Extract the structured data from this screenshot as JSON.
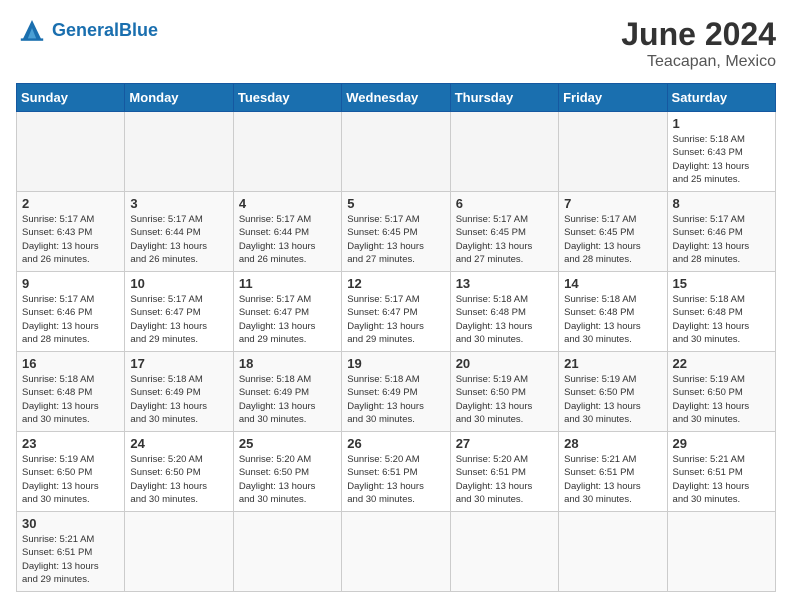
{
  "header": {
    "logo_general": "General",
    "logo_blue": "Blue",
    "title": "June 2024",
    "subtitle": "Teacapan, Mexico"
  },
  "days_of_week": [
    "Sunday",
    "Monday",
    "Tuesday",
    "Wednesday",
    "Thursday",
    "Friday",
    "Saturday"
  ],
  "weeks": [
    [
      {
        "day": "",
        "info": ""
      },
      {
        "day": "",
        "info": ""
      },
      {
        "day": "",
        "info": ""
      },
      {
        "day": "",
        "info": ""
      },
      {
        "day": "",
        "info": ""
      },
      {
        "day": "",
        "info": ""
      },
      {
        "day": "1",
        "info": "Sunrise: 5:18 AM\nSunset: 6:43 PM\nDaylight: 13 hours\nand 25 minutes."
      }
    ],
    [
      {
        "day": "2",
        "info": "Sunrise: 5:17 AM\nSunset: 6:43 PM\nDaylight: 13 hours\nand 26 minutes."
      },
      {
        "day": "3",
        "info": "Sunrise: 5:17 AM\nSunset: 6:44 PM\nDaylight: 13 hours\nand 26 minutes."
      },
      {
        "day": "4",
        "info": "Sunrise: 5:17 AM\nSunset: 6:44 PM\nDaylight: 13 hours\nand 26 minutes."
      },
      {
        "day": "5",
        "info": "Sunrise: 5:17 AM\nSunset: 6:45 PM\nDaylight: 13 hours\nand 27 minutes."
      },
      {
        "day": "6",
        "info": "Sunrise: 5:17 AM\nSunset: 6:45 PM\nDaylight: 13 hours\nand 27 minutes."
      },
      {
        "day": "7",
        "info": "Sunrise: 5:17 AM\nSunset: 6:45 PM\nDaylight: 13 hours\nand 28 minutes."
      },
      {
        "day": "8",
        "info": "Sunrise: 5:17 AM\nSunset: 6:46 PM\nDaylight: 13 hours\nand 28 minutes."
      }
    ],
    [
      {
        "day": "9",
        "info": "Sunrise: 5:17 AM\nSunset: 6:46 PM\nDaylight: 13 hours\nand 28 minutes."
      },
      {
        "day": "10",
        "info": "Sunrise: 5:17 AM\nSunset: 6:47 PM\nDaylight: 13 hours\nand 29 minutes."
      },
      {
        "day": "11",
        "info": "Sunrise: 5:17 AM\nSunset: 6:47 PM\nDaylight: 13 hours\nand 29 minutes."
      },
      {
        "day": "12",
        "info": "Sunrise: 5:17 AM\nSunset: 6:47 PM\nDaylight: 13 hours\nand 29 minutes."
      },
      {
        "day": "13",
        "info": "Sunrise: 5:18 AM\nSunset: 6:48 PM\nDaylight: 13 hours\nand 30 minutes."
      },
      {
        "day": "14",
        "info": "Sunrise: 5:18 AM\nSunset: 6:48 PM\nDaylight: 13 hours\nand 30 minutes."
      },
      {
        "day": "15",
        "info": "Sunrise: 5:18 AM\nSunset: 6:48 PM\nDaylight: 13 hours\nand 30 minutes."
      }
    ],
    [
      {
        "day": "16",
        "info": "Sunrise: 5:18 AM\nSunset: 6:48 PM\nDaylight: 13 hours\nand 30 minutes."
      },
      {
        "day": "17",
        "info": "Sunrise: 5:18 AM\nSunset: 6:49 PM\nDaylight: 13 hours\nand 30 minutes."
      },
      {
        "day": "18",
        "info": "Sunrise: 5:18 AM\nSunset: 6:49 PM\nDaylight: 13 hours\nand 30 minutes."
      },
      {
        "day": "19",
        "info": "Sunrise: 5:18 AM\nSunset: 6:49 PM\nDaylight: 13 hours\nand 30 minutes."
      },
      {
        "day": "20",
        "info": "Sunrise: 5:19 AM\nSunset: 6:50 PM\nDaylight: 13 hours\nand 30 minutes."
      },
      {
        "day": "21",
        "info": "Sunrise: 5:19 AM\nSunset: 6:50 PM\nDaylight: 13 hours\nand 30 minutes."
      },
      {
        "day": "22",
        "info": "Sunrise: 5:19 AM\nSunset: 6:50 PM\nDaylight: 13 hours\nand 30 minutes."
      }
    ],
    [
      {
        "day": "23",
        "info": "Sunrise: 5:19 AM\nSunset: 6:50 PM\nDaylight: 13 hours\nand 30 minutes."
      },
      {
        "day": "24",
        "info": "Sunrise: 5:20 AM\nSunset: 6:50 PM\nDaylight: 13 hours\nand 30 minutes."
      },
      {
        "day": "25",
        "info": "Sunrise: 5:20 AM\nSunset: 6:50 PM\nDaylight: 13 hours\nand 30 minutes."
      },
      {
        "day": "26",
        "info": "Sunrise: 5:20 AM\nSunset: 6:51 PM\nDaylight: 13 hours\nand 30 minutes."
      },
      {
        "day": "27",
        "info": "Sunrise: 5:20 AM\nSunset: 6:51 PM\nDaylight: 13 hours\nand 30 minutes."
      },
      {
        "day": "28",
        "info": "Sunrise: 5:21 AM\nSunset: 6:51 PM\nDaylight: 13 hours\nand 30 minutes."
      },
      {
        "day": "29",
        "info": "Sunrise: 5:21 AM\nSunset: 6:51 PM\nDaylight: 13 hours\nand 30 minutes."
      }
    ],
    [
      {
        "day": "30",
        "info": "Sunrise: 5:21 AM\nSunset: 6:51 PM\nDaylight: 13 hours\nand 29 minutes."
      },
      {
        "day": "",
        "info": ""
      },
      {
        "day": "",
        "info": ""
      },
      {
        "day": "",
        "info": ""
      },
      {
        "day": "",
        "info": ""
      },
      {
        "day": "",
        "info": ""
      },
      {
        "day": "",
        "info": ""
      }
    ]
  ]
}
